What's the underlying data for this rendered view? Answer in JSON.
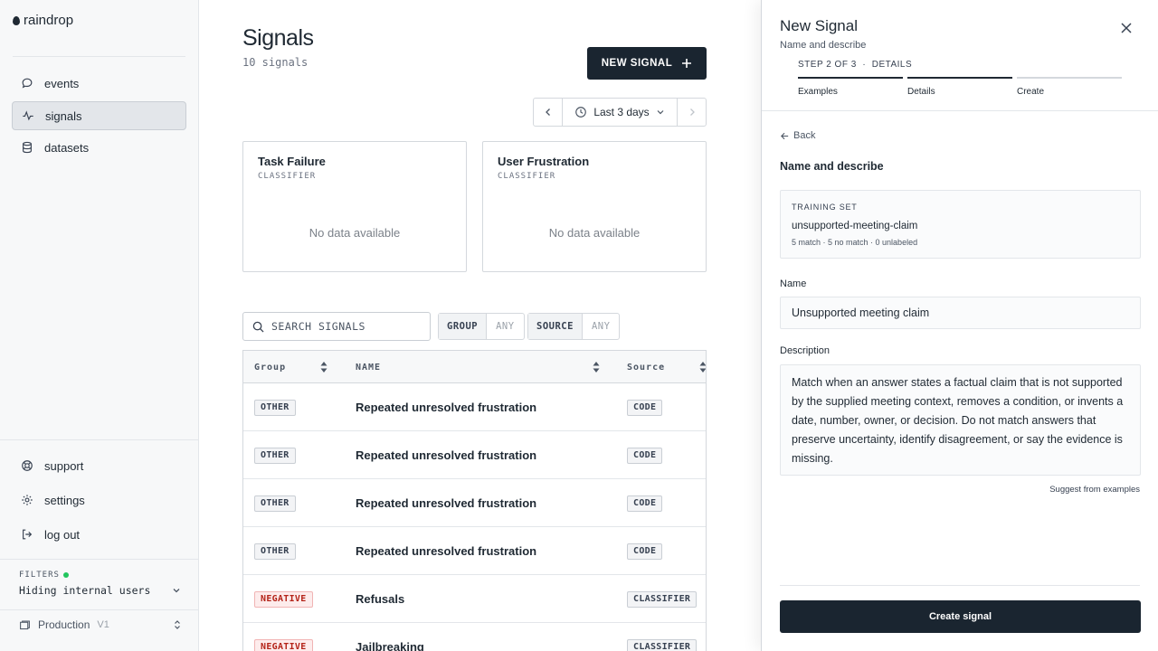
{
  "app": {
    "logo_text": "raindrop"
  },
  "sidebar": {
    "nav": [
      {
        "label": "events",
        "icon": "chat-bubble-icon",
        "active": false
      },
      {
        "label": "signals",
        "icon": "activity-icon",
        "active": true
      },
      {
        "label": "datasets",
        "icon": "database-icon",
        "active": false
      }
    ],
    "bottom": [
      {
        "label": "support",
        "icon": "lifebuoy-icon"
      },
      {
        "label": "settings",
        "icon": "gear-icon"
      },
      {
        "label": "log out",
        "icon": "logout-icon"
      }
    ],
    "filters": {
      "label": "FILTERS",
      "value": "Hiding internal users",
      "status_color": "#22c55e"
    },
    "environment": {
      "name": "Production",
      "version": "V1"
    }
  },
  "main": {
    "title": "Signals",
    "count": "10 signals",
    "new_button": "NEW SIGNAL",
    "date_range": "Last 3 days",
    "cards": [
      {
        "title": "Task Failure",
        "type": "CLASSIFIER",
        "empty": "No data available"
      },
      {
        "title": "User Frustration",
        "type": "CLASSIFIER",
        "empty": "No data available"
      }
    ],
    "search_placeholder": "SEARCH SIGNALS",
    "filter_group": {
      "key": "GROUP",
      "value": "ANY"
    },
    "filter_source": {
      "key": "SOURCE",
      "value": "ANY"
    },
    "table": {
      "headers": [
        "Group",
        "NAME",
        "Source"
      ],
      "rows": [
        {
          "group": "OTHER",
          "name": "Repeated unresolved frustration",
          "source": "CODE"
        },
        {
          "group": "OTHER",
          "name": "Repeated unresolved frustration",
          "source": "CODE"
        },
        {
          "group": "OTHER",
          "name": "Repeated unresolved frustration",
          "source": "CODE"
        },
        {
          "group": "OTHER",
          "name": "Repeated unresolved frustration",
          "source": "CODE"
        },
        {
          "group": "NEGATIVE",
          "name": "Refusals",
          "source": "CLASSIFIER"
        },
        {
          "group": "NEGATIVE",
          "name": "Jailbreaking",
          "source": "CLASSIFIER"
        }
      ]
    }
  },
  "panel": {
    "title": "New Signal",
    "subtitle": "Name and describe",
    "step_text": "STEP 2 OF 3  ·  DETAILS",
    "steps": [
      "Examples",
      "Details",
      "Create"
    ],
    "back": "Back",
    "section": "Name and describe",
    "training_set": {
      "label": "TRAINING SET",
      "name": "unsupported-meeting-claim",
      "meta": "5 match · 5 no match · 0 unlabeled"
    },
    "name_label": "Name",
    "name_value": "Unsupported meeting claim",
    "description_label": "Description",
    "description_value": "Match when an answer states a factual claim that is not supported by the supplied meeting context, removes a condition, or invents a date, number, owner, or decision. Do not match answers that preserve uncertainty, identify disagreement, or say the evidence is missing.",
    "suggest": "Suggest from examples",
    "create_button": "Create signal"
  }
}
